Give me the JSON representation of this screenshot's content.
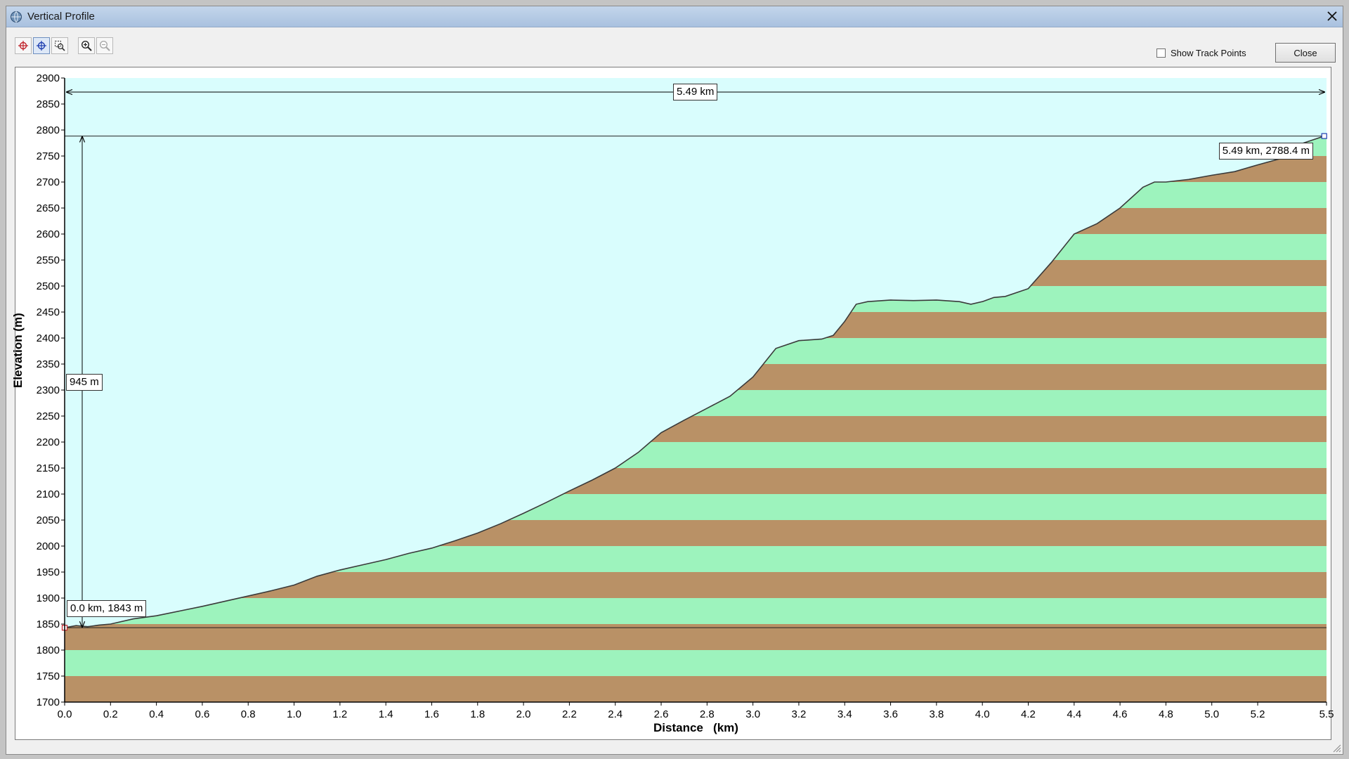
{
  "window": {
    "title": "Vertical Profile",
    "app_icon": "globe-icon"
  },
  "toolbar": {
    "buttons": [
      {
        "name": "set-start-point",
        "icon": "crosshair-red-icon",
        "pressed": false
      },
      {
        "name": "set-end-point",
        "icon": "crosshair-blue-icon",
        "pressed": true
      },
      {
        "name": "select-range",
        "icon": "select-zoom-icon",
        "pressed": false
      },
      {
        "name": "zoom-in",
        "icon": "zoom-in-icon",
        "pressed": false
      },
      {
        "name": "zoom-out",
        "icon": "zoom-out-icon",
        "pressed": false,
        "disabled": true
      }
    ]
  },
  "controls": {
    "show_track_points_label": "Show Track Points",
    "show_track_points_checked": false,
    "close_label": "Close"
  },
  "annotations": {
    "distance": "5.49 km",
    "elevation_gain": "945 m",
    "start_point": "0.0 km, 1843 m",
    "end_point": "5.49 km, 2788.4 m"
  },
  "colors": {
    "sky": "#d9fdfd",
    "band_green": "#9df3bd",
    "band_brown": "#b99166",
    "profile_line": "#3a3a3a"
  },
  "chart_data": {
    "type": "area",
    "xlabel": "Distance   (km)",
    "ylabel": "Elevation (m)",
    "xlim": [
      0,
      5.5
    ],
    "ylim": [
      1700,
      2900
    ],
    "x_ticks": [
      "0.0",
      "0.2",
      "0.4",
      "0.6",
      "0.8",
      "1.0",
      "1.2",
      "1.4",
      "1.6",
      "1.8",
      "2.0",
      "2.2",
      "2.4",
      "2.6",
      "2.8",
      "3.0",
      "3.2",
      "3.4",
      "3.6",
      "3.8",
      "4.0",
      "4.2",
      "4.4",
      "4.6",
      "4.8",
      "5.0",
      "5.2",
      "5.5"
    ],
    "y_ticks": [
      "2900",
      "2850",
      "2800",
      "2750",
      "2700",
      "2650",
      "2600",
      "2550",
      "2500",
      "2450",
      "2400",
      "2350",
      "2300",
      "2250",
      "2200",
      "2150",
      "2100",
      "2050",
      "2000",
      "1950",
      "1900",
      "1850",
      "1800",
      "1750",
      "1700"
    ],
    "band_step_m": 50,
    "reference_lines_m": [
      1843,
      2788.4
    ],
    "series": [
      {
        "x": [
          0.0,
          0.05,
          0.1,
          0.15,
          0.2,
          0.3,
          0.4,
          0.5,
          0.6,
          0.7,
          0.8,
          0.9,
          1.0,
          1.1,
          1.2,
          1.3,
          1.4,
          1.5,
          1.6,
          1.7,
          1.8,
          1.9,
          2.0,
          2.1,
          2.2,
          2.3,
          2.4,
          2.5,
          2.6,
          2.7,
          2.8,
          2.9,
          3.0,
          3.1,
          3.2,
          3.3,
          3.35,
          3.4,
          3.45,
          3.5,
          3.6,
          3.7,
          3.8,
          3.9,
          3.95,
          4.0,
          4.05,
          4.1,
          4.2,
          4.3,
          4.4,
          4.5,
          4.6,
          4.7,
          4.75,
          4.8,
          4.9,
          5.0,
          5.1,
          5.2,
          5.3,
          5.4,
          5.49
        ],
        "y": [
          1843,
          1847,
          1845,
          1848,
          1850,
          1860,
          1866,
          1875,
          1884,
          1894,
          1904,
          1914,
          1925,
          1942,
          1954,
          1964,
          1974,
          1986,
          1996,
          2010,
          2025,
          2043,
          2063,
          2084,
          2106,
          2127,
          2150,
          2180,
          2218,
          2242,
          2265,
          2288,
          2325,
          2380,
          2395,
          2398,
          2405,
          2432,
          2465,
          2470,
          2473,
          2472,
          2473,
          2470,
          2465,
          2470,
          2478,
          2480,
          2495,
          2545,
          2600,
          2620,
          2650,
          2690,
          2700,
          2700,
          2705,
          2713,
          2720,
          2733,
          2745,
          2775,
          2788.4
        ]
      }
    ]
  }
}
